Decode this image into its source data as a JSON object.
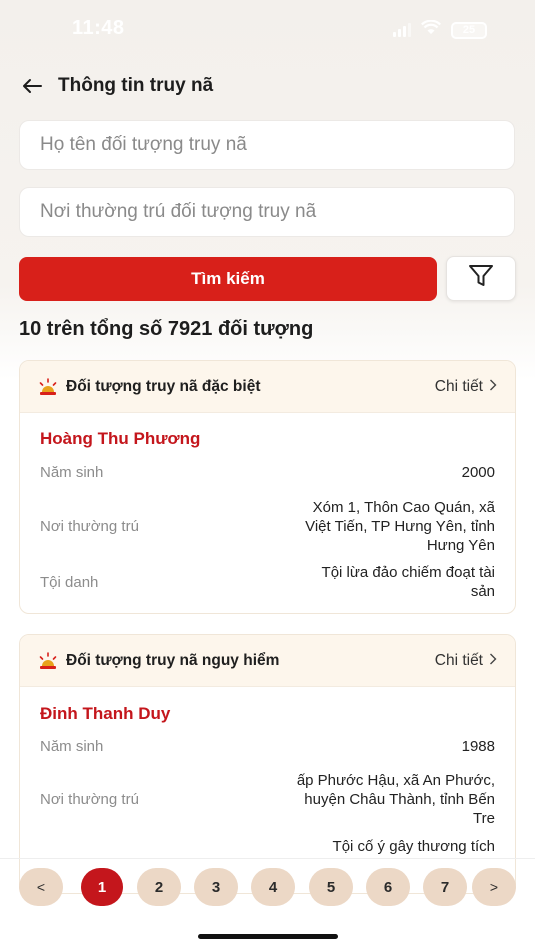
{
  "status_bar": {
    "time": "11:48",
    "battery": "25"
  },
  "header": {
    "title": "Thông tin truy nã"
  },
  "search": {
    "name_placeholder": "Họ tên đối tượng truy nã",
    "address_placeholder": "Nơi thường trú đối tượng truy nã",
    "button_label": "Tìm kiếm"
  },
  "results": {
    "summary": "10 trên tổng số 7921 đối tượng"
  },
  "records": [
    {
      "category": "Đối tượng truy nã đặc biệt",
      "detail_label": "Chi tiết",
      "name": "Hoàng Thu Phương",
      "birth_label": "Năm sinh",
      "birth_year": "2000",
      "address_label": "Nơi thường trú",
      "address_lines": [
        "Xóm 1, Thôn Cao Quán, xã",
        "Việt Tiến, TP Hưng Yên, tỉnh",
        "Hưng Yên"
      ],
      "crime_label": "Tội danh",
      "crime_lines": [
        "Tội lừa đảo chiếm đoạt tài",
        "sản"
      ]
    },
    {
      "category": "Đối tượng truy nã nguy hiểm",
      "detail_label": "Chi tiết",
      "name": "Đinh Thanh Duy",
      "birth_label": "Năm sinh",
      "birth_year": "1988",
      "address_label": "Nơi thường trú",
      "address_lines": [
        "ấp Phước Hậu, xã An Phước,",
        "huyện Châu Thành, tỉnh Bến",
        "Tre"
      ],
      "crime_lines": [
        "Tội cố ý gây thương tích"
      ]
    }
  ],
  "pagination": {
    "prev": "<",
    "next": ">",
    "pages": [
      "1",
      "2",
      "3",
      "4",
      "5",
      "6",
      "7"
    ],
    "current": "1"
  },
  "colors": {
    "primary_red": "#d8201a",
    "name_red": "#c4161c",
    "page_bg": "#ecd8c6",
    "card_head_bg": "#fdf6ec"
  },
  "icons": [
    "back-arrow-icon",
    "filter-icon",
    "siren-icon",
    "chevron-right-icon",
    "wifi-icon",
    "signal-icon",
    "battery-icon"
  ]
}
